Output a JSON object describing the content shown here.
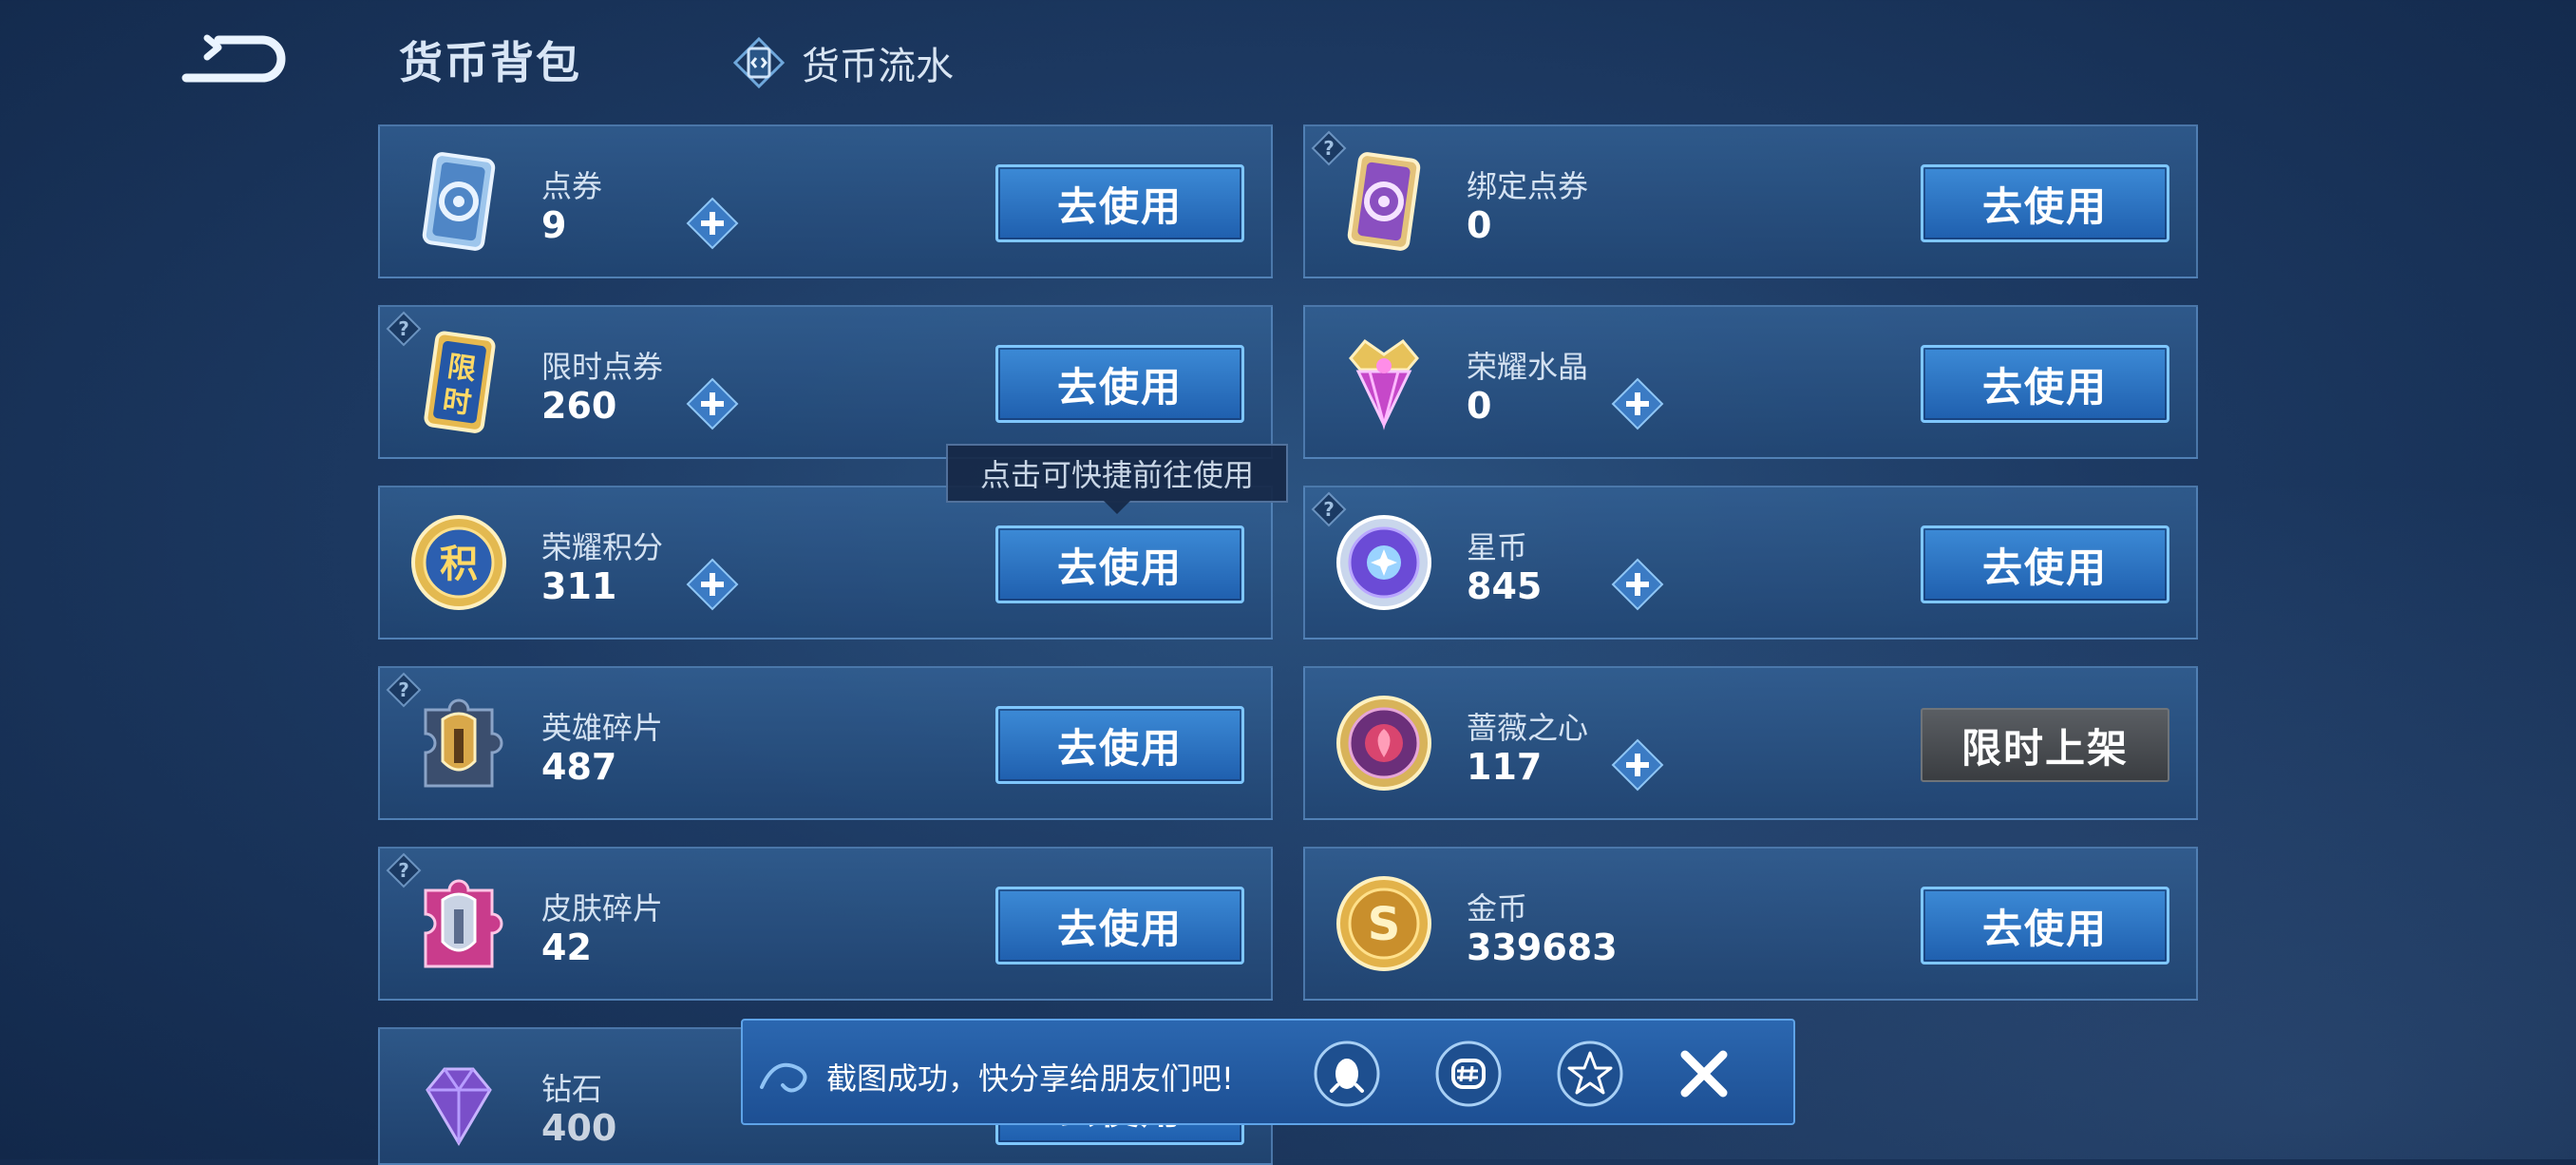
{
  "header": {
    "title": "货币背包",
    "flow_tab_label": "货币流水"
  },
  "use_label": "去使用",
  "currencies": [
    {
      "name": "点券",
      "amount": "9",
      "icon": "coupon-blue-icon"
    },
    {
      "name": "绑定点券",
      "amount": "0",
      "icon": "coupon-purple-icon"
    },
    {
      "name": "限时点券",
      "amount": "260",
      "icon": "limited-coupon-icon"
    },
    {
      "name": "荣耀水晶",
      "amount": "0",
      "icon": "glory-crystal-icon"
    },
    {
      "name": "荣耀积分",
      "amount": "311",
      "icon": "glory-points-icon"
    },
    {
      "name": "星币",
      "amount": "845",
      "icon": "star-coin-icon"
    },
    {
      "name": "英雄碎片",
      "amount": "487",
      "icon": "hero-fragment-icon"
    },
    {
      "name": "蔷薇之心",
      "amount": "117",
      "icon": "rose-heart-icon",
      "action": "限时上架"
    },
    {
      "name": "皮肤碎片",
      "amount": "42",
      "icon": "skin-fragment-icon"
    },
    {
      "name": "金币",
      "amount": "339683",
      "icon": "gold-coin-icon"
    },
    {
      "name": "钻石",
      "amount": "400",
      "icon": "diamond-icon"
    }
  ],
  "tooltip": "点击可快捷前往使用",
  "share_toast": {
    "text": "截图成功，快分享给朋友们吧!",
    "icons": [
      "qq-icon",
      "wechat-moments-icon",
      "qzone-icon",
      "close-icon"
    ]
  },
  "colors": {
    "accent": "#3c8ad6",
    "button_border": "#7fc7ff",
    "limited_button": "#4a4e53",
    "background": "#1d3a63"
  }
}
